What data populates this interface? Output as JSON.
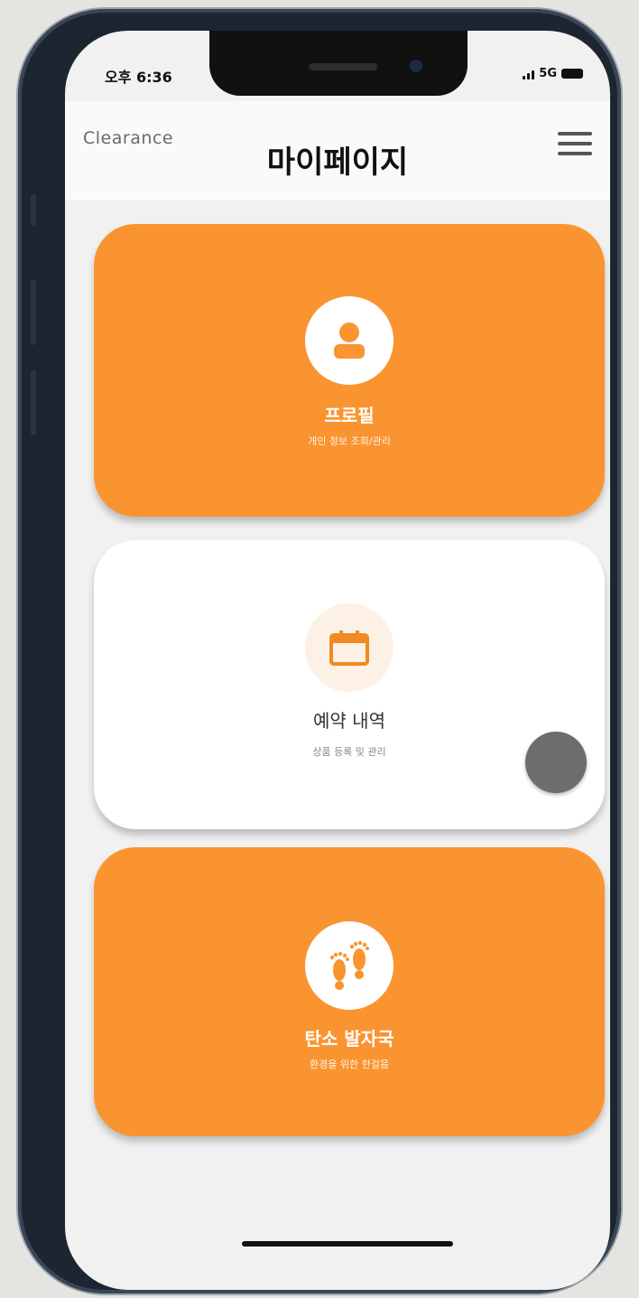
{
  "status_bar": {
    "time": "오후 6:36",
    "network": "5G"
  },
  "header": {
    "brand": "Clearance",
    "title": "마이페이지"
  },
  "cards": [
    {
      "title": "프로필",
      "subtitle": "개인 정보 조회/관리",
      "icon": "user-icon",
      "color": "#fa9430"
    },
    {
      "title": "예약 내역",
      "subtitle": "상품 등록 및 관리",
      "icon": "calendar-icon",
      "color": "#ffffff"
    },
    {
      "title": "탄소 발자국",
      "subtitle": "환경을 위한 한걸음",
      "icon": "footprints-icon",
      "color": "#fa9430"
    }
  ],
  "colors": {
    "accent": "#fa9430",
    "fab": "#6d6d6d"
  }
}
